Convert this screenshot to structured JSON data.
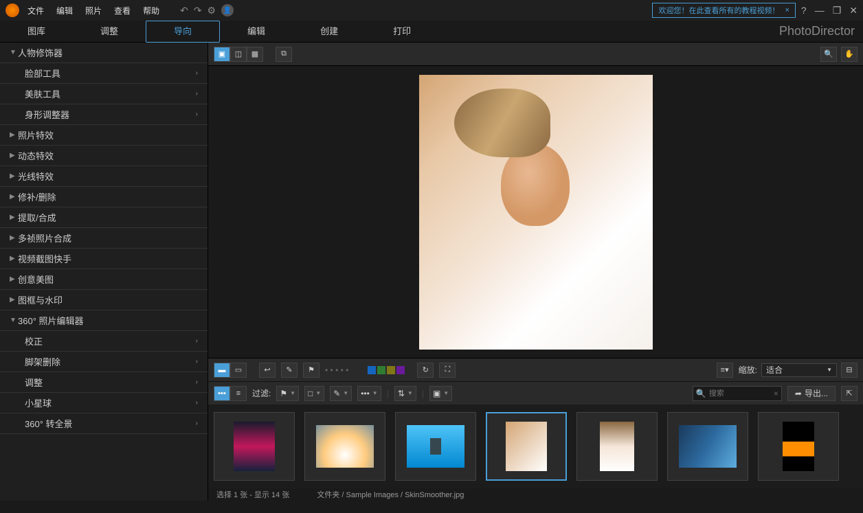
{
  "menu": {
    "file": "文件",
    "edit": "编辑",
    "photo": "照片",
    "view": "查看",
    "help": "帮助"
  },
  "welcome": {
    "text": "欢迎您！在此查看所有的教程视频！",
    "close": "×"
  },
  "brand": "PhotoDirector",
  "tabs": {
    "library": "图库",
    "adjust": "调整",
    "guided": "导向",
    "edit": "编辑",
    "create": "创建",
    "print": "打印"
  },
  "sidebar": {
    "people": {
      "label": "人物修饰器"
    },
    "face": {
      "label": "脸部工具"
    },
    "skin": {
      "label": "美肤工具"
    },
    "body": {
      "label": "身形调整器"
    },
    "effects": {
      "label": "照片特效"
    },
    "animEffects": {
      "label": "动态特效"
    },
    "light": {
      "label": "光线特效"
    },
    "repair": {
      "label": "修补/删除"
    },
    "extract": {
      "label": "提取/合成"
    },
    "multi": {
      "label": "多祯照片合成"
    },
    "video": {
      "label": "视频截图快手"
    },
    "creative": {
      "label": "创意美图"
    },
    "frame": {
      "label": "图框与水印"
    },
    "pano360": {
      "label": "360° 照片编辑器"
    },
    "correct": {
      "label": "校正"
    },
    "tripod": {
      "label": "脚架删除"
    },
    "adjust": {
      "label": "调整"
    },
    "planet": {
      "label": "小星球"
    },
    "toPano": {
      "label": "360° 转全景"
    }
  },
  "toolbar": {
    "zoomLabel": "缩放:",
    "zoomValue": "适合"
  },
  "filter": {
    "label": "过滤:",
    "searchPlaceholder": "搜索",
    "export": "导出..."
  },
  "status": {
    "selection": "选择 1 张 - 显示 14 张",
    "folderLabel": "文件夹",
    "folderPath": "/ Sample Images / SkinSmoother.jpg"
  },
  "colors": {
    "red": "#c62828",
    "blue": "#1565c0",
    "green": "#2e7d32",
    "olive": "#827717",
    "purple": "#6a1b9a"
  }
}
